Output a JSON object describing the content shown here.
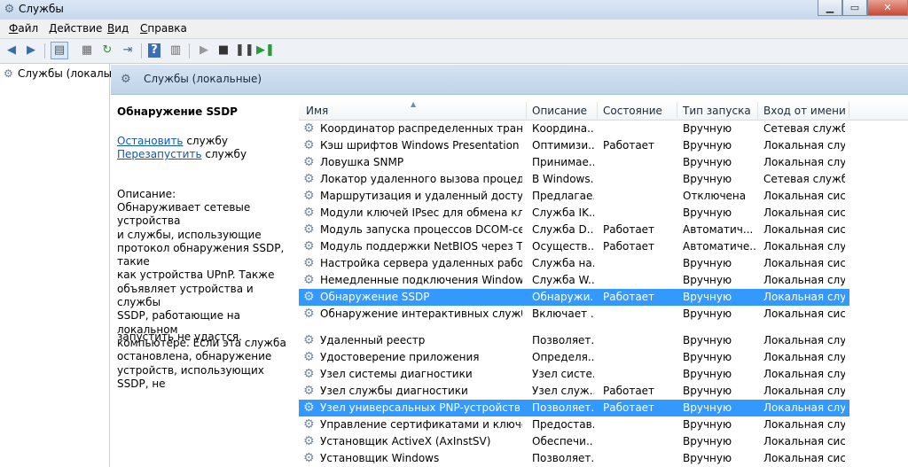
{
  "window": {
    "title": "Службы",
    "btn_min": "▁",
    "btn_max": "▭",
    "btn_close": "✕"
  },
  "menu": [
    {
      "key": "Ф",
      "rest": "айл"
    },
    {
      "key": "Д",
      "rest": "ействие"
    },
    {
      "key": "В",
      "rest": "ид"
    },
    {
      "key": "С",
      "rest": "правка"
    }
  ],
  "toolbar_icons": [
    "back-icon",
    "forward-icon",
    "console-tree-icon",
    "properties-icon",
    "refresh-icon",
    "export-icon",
    "help-icon",
    "action-pane-icon",
    "start-service-icon",
    "stop-service-icon",
    "pause-service-icon",
    "restart-service-icon"
  ],
  "tree": {
    "label": "Службы (локалы"
  },
  "header": {
    "title": "Службы (локальные)"
  },
  "desc": {
    "service_name": "Обнаружение SSDP",
    "stop_link": "Остановить",
    "stop_suffix": " службу",
    "restart_link": "Перезапустить",
    "restart_suffix": " службу",
    "label": "Описание:",
    "lines": [
      "Обнаруживает сетевые устройства",
      "и службы, использующие",
      "протокол обнаружения SSDP, такие",
      "как устройства UPnP. Также",
      "объявляет устройства и службы",
      "SSDP, работающие на локальном",
      "компьютере. Если эта служба",
      "остановлена, обнаружение",
      "устройств, использующих SSDP, не"
    ],
    "tail": "запустить не удастся."
  },
  "columns": [
    "Имя",
    "Описание",
    "Состояние",
    "Тип запуска",
    "Вход от имени"
  ],
  "rows": [
    [
      "Координатор распределенных транзакц...",
      "Координа...",
      "",
      "Вручную",
      "Сетевая служба"
    ],
    [
      "Кэш шрифтов Windows Presentation Fo...",
      "Оптимизи...",
      "Работает",
      "Вручную",
      "Локальная слу..."
    ],
    [
      "Ловушка SNMP",
      "Принимае...",
      "",
      "Вручную",
      "Локальная слу..."
    ],
    [
      "Локатор удаленного вызова процедур ...",
      "В Windows...",
      "",
      "Вручную",
      "Сетевая служба"
    ],
    [
      "Маршрутизация и удаленный доступ",
      "Предлагае...",
      "",
      "Отключена",
      "Локальная сис..."
    ],
    [
      "Модули ключей IPsec для обмена ключ...",
      "Служба IK...",
      "",
      "Вручную",
      "Локальная сис..."
    ],
    [
      "Модуль запуска процессов DCOM-серв...",
      "Служба D...",
      "Работает",
      "Автоматич...",
      "Локальная сис..."
    ],
    [
      "Модуль поддержки NetBIOS через TCP/IP",
      "Осуществ...",
      "Работает",
      "Автоматиче...",
      "Локальная слу..."
    ],
    [
      "Настройка сервера удаленных рабочих ...",
      "Служба на...",
      "",
      "Вручную",
      "Локальная сис..."
    ],
    [
      "Немедленные подключения Windows - ...",
      "Служба W...",
      "",
      "Вручную",
      "Локальная слу..."
    ],
    [
      "Обнаружение SSDP",
      "Обнаружи...",
      "Работает",
      "Вручную",
      "Локальная слу..."
    ],
    [
      "Обнаружение интерактивных служб",
      "Включает ...",
      "",
      "Вручную",
      "Локальная сис..."
    ],
    [
      "Удаленный реестр",
      "Позволяет...",
      "",
      "Вручную",
      "Локальная слу..."
    ],
    [
      "Удостоверение приложения",
      "Определя...",
      "",
      "Вручную",
      "Локальная слу..."
    ],
    [
      "Узел системы диагностики",
      "Узел систе...",
      "",
      "Вручную",
      "Локальная слу..."
    ],
    [
      "Узел службы диагностики",
      "Узел служ...",
      "Работает",
      "Вручную",
      "Локальная слу..."
    ],
    [
      "Узел универсальных PNP-устройств",
      "Позволяет...",
      "Работает",
      "Вручную",
      "Локальная слу..."
    ],
    [
      "Управление сертификатами и ключом ...",
      "Предостав...",
      "",
      "Вручную",
      "Локальная слу..."
    ],
    [
      "Установщик ActiveX (AxInstSV)",
      "Обеспечи...",
      "",
      "Вручную",
      "Локальная сис..."
    ],
    [
      "Установщик Windows",
      "Позволяет...",
      "",
      "Вручную",
      "Локальная сис..."
    ]
  ],
  "selected_rows": [
    10,
    16
  ]
}
